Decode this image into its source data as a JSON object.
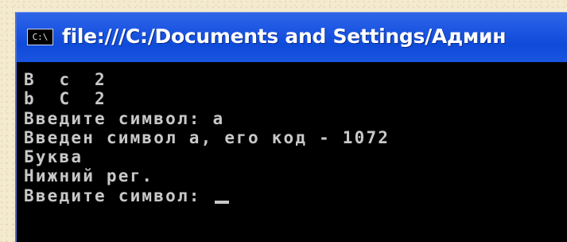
{
  "window": {
    "icon_label": "C:\\",
    "icon": "console-icon",
    "title": "file:///C:/Documents and Settings/Админ"
  },
  "console": {
    "lines": [
      "B  c  2",
      "b  C  2",
      "Введите символ: а",
      "Введен символ а, его код - 1072",
      "Буква",
      "Нижний рег.",
      "Введите символ: "
    ]
  },
  "colors": {
    "title_bar": "#1f58e3",
    "console_bg": "#000000",
    "console_text": "#c8c8c8"
  }
}
